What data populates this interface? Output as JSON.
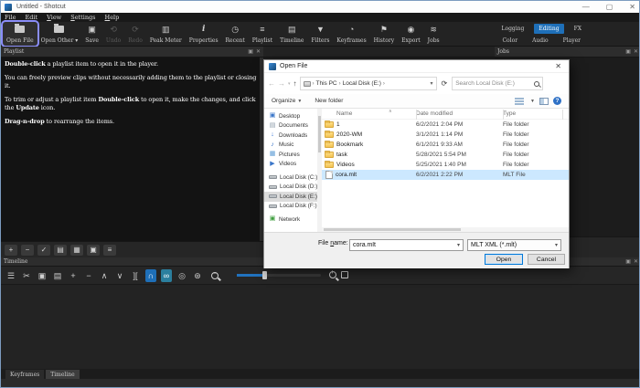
{
  "window": {
    "title": "Untitled - Shotcut"
  },
  "menu_items": [
    "File",
    "Edit",
    "View",
    "Settings",
    "Help"
  ],
  "toolbar": {
    "buttons": [
      {
        "name": "open-file",
        "label": "Open File",
        "icon": "open-folder",
        "highlighted": true
      },
      {
        "name": "open-other",
        "label": "Open Other",
        "icon": "open-folder",
        "caret": true
      },
      {
        "name": "save",
        "label": "Save",
        "icon": "floppy"
      },
      {
        "name": "undo",
        "label": "Undo",
        "icon": "undo",
        "disabled": true
      },
      {
        "name": "redo",
        "label": "Redo",
        "icon": "redo",
        "disabled": true
      },
      {
        "name": "peak-meter",
        "label": "Peak Meter",
        "icon": "meter"
      },
      {
        "name": "properties",
        "label": "Properties",
        "icon": "info"
      },
      {
        "name": "recent",
        "label": "Recent",
        "icon": "clock"
      },
      {
        "name": "playlist",
        "label": "Playlist",
        "icon": "list"
      },
      {
        "name": "timeline",
        "label": "Timeline",
        "icon": "timeline"
      },
      {
        "name": "filters",
        "label": "Filters",
        "icon": "funnel"
      },
      {
        "name": "keyframes",
        "label": "Keyframes",
        "icon": "stopwatch"
      },
      {
        "name": "history",
        "label": "History",
        "icon": "flag"
      },
      {
        "name": "export",
        "label": "Export",
        "icon": "disc"
      },
      {
        "name": "jobs",
        "label": "Jobs",
        "icon": "stack"
      }
    ],
    "layout_rows": [
      [
        "Logging",
        "Editing",
        "FX"
      ],
      [
        "Color",
        "Audio",
        "Player"
      ]
    ],
    "active_layout": "Editing"
  },
  "playlist_panel": {
    "title": "Playlist",
    "paragraphs": [
      [
        {
          "t": "Double-click",
          "b": true
        },
        {
          "t": " a playlist item to open it in the player."
        }
      ],
      [
        {
          "t": "You can freely preview clips without necessarily adding them to the playlist or closing it."
        }
      ],
      [
        {
          "t": "To trim or adjust a playlist item "
        },
        {
          "t": "Double-click",
          "b": true
        },
        {
          "t": " to open it, make the changes, and click the "
        },
        {
          "t": "Update",
          "b": true
        },
        {
          "t": " icon."
        }
      ],
      [
        {
          "t": "Drag-n-drop",
          "b": true
        },
        {
          "t": " to rearrange the items."
        }
      ]
    ],
    "bottom_icons": [
      {
        "name": "append",
        "glyph": "+"
      },
      {
        "name": "remove",
        "glyph": "−"
      },
      {
        "name": "update",
        "glyph": "✓"
      },
      {
        "name": "view-details",
        "glyph": "▤"
      },
      {
        "name": "view-tiles",
        "glyph": "▦"
      },
      {
        "name": "view-icons",
        "glyph": "▣"
      },
      {
        "name": "playlist-menu",
        "glyph": "≡"
      }
    ]
  },
  "jobs_panel": {
    "title": "Jobs"
  },
  "timeline_panel": {
    "title": "Timeline",
    "toolbar_icons": [
      {
        "name": "timeline-menu",
        "glyph": "☰"
      },
      {
        "name": "cut",
        "glyph": "✂"
      },
      {
        "name": "copy",
        "glyph": "▣"
      },
      {
        "name": "paste",
        "glyph": "▤"
      },
      {
        "name": "append",
        "glyph": "+"
      },
      {
        "name": "ripple-delete",
        "glyph": "−"
      },
      {
        "name": "lift",
        "glyph": "∧"
      },
      {
        "name": "overwrite",
        "glyph": "∨"
      },
      {
        "name": "split",
        "glyph": "]["
      },
      {
        "name": "snap",
        "glyph": "∩",
        "active": "blue"
      },
      {
        "name": "scrub-while-dragging",
        "glyph": "∞",
        "active": "teal"
      },
      {
        "name": "ripple",
        "glyph": "◎"
      },
      {
        "name": "ripple-all-tracks",
        "glyph": "⊛"
      }
    ]
  },
  "tabs": [
    {
      "label": "Keyframes",
      "active": false
    },
    {
      "label": "Timeline",
      "active": true
    }
  ],
  "dialog": {
    "title": "Open File",
    "breadcrumb": [
      "This PC",
      "Local Disk (E:)"
    ],
    "search_placeholder": "Search Local Disk (E:)",
    "organize_label": "Organize",
    "new_folder_label": "New folder",
    "sidebar": [
      {
        "label": "Desktop",
        "icon": "desktop"
      },
      {
        "label": "Documents",
        "icon": "documents"
      },
      {
        "label": "Downloads",
        "icon": "downloads"
      },
      {
        "label": "Music",
        "icon": "music"
      },
      {
        "label": "Pictures",
        "icon": "pictures"
      },
      {
        "label": "Videos",
        "icon": "videos"
      },
      {
        "label": "Local Disk (C:)",
        "icon": "drive",
        "gap": true
      },
      {
        "label": "Local Disk (D:)",
        "icon": "drive"
      },
      {
        "label": "Local Disk (E:)",
        "icon": "drive",
        "selected": true
      },
      {
        "label": "Local Disk (F:)",
        "icon": "drive"
      },
      {
        "label": "Network",
        "icon": "network",
        "gap": true
      }
    ],
    "columns": [
      "Name",
      "Date modified",
      "Type"
    ],
    "files": [
      {
        "name": "1",
        "date": "6/2/2021 2:04 PM",
        "type": "File folder",
        "icon": "folder"
      },
      {
        "name": "2020-WM",
        "date": "3/1/2021 1:14 PM",
        "type": "File folder",
        "icon": "folder"
      },
      {
        "name": "Bookmark",
        "date": "6/1/2021 9:33 AM",
        "type": "File folder",
        "icon": "folder"
      },
      {
        "name": "task",
        "date": "5/28/2021 5:54 PM",
        "type": "File folder",
        "icon": "folder"
      },
      {
        "name": "Videos",
        "date": "5/25/2021 1:40 PM",
        "type": "File folder",
        "icon": "folder"
      },
      {
        "name": "cora.mlt",
        "date": "6/2/2021 2:22 PM",
        "type": "MLT File",
        "icon": "file",
        "selected": true
      }
    ],
    "file_name_label": {
      "pre": "File ",
      "mn": "n",
      "post": "ame:"
    },
    "file_name_value": "cora.mlt",
    "file_type_value": "MLT XML (*.mlt)",
    "open_label": "Open",
    "cancel_label": "Cancel"
  },
  "colors": {
    "accent": "#2172be",
    "highlight_ring": "#8a8df8",
    "selection": "#cce8ff"
  }
}
